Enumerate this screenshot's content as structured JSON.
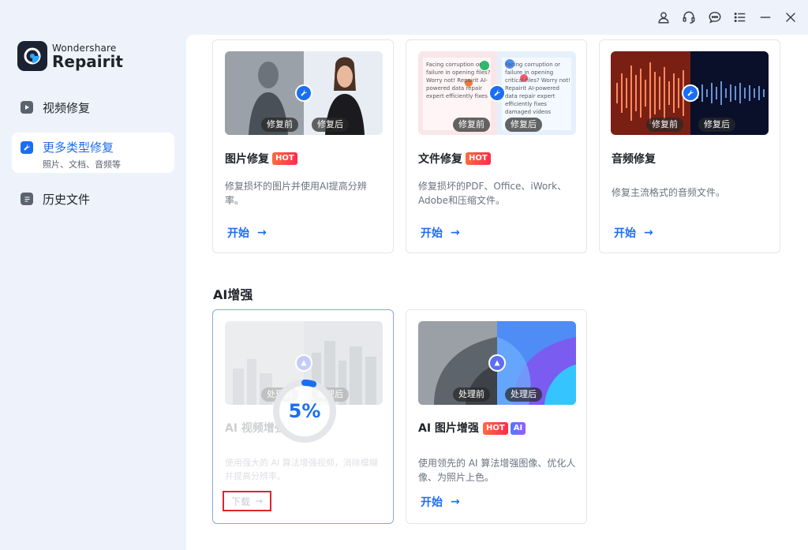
{
  "app": {
    "brand": "Wondershare",
    "product": "Repairit"
  },
  "titlebar": {
    "icons": [
      "account-icon",
      "headset-support-icon",
      "chat-feedback-icon",
      "menu-list-icon",
      "minimize-icon",
      "close-icon"
    ]
  },
  "sidebar": {
    "items": [
      {
        "label": "视频修复",
        "sub": "",
        "active": false,
        "icon": "play-icon"
      },
      {
        "label": "更多类型修复",
        "sub": "照片、文档、音频等",
        "active": true,
        "icon": "wrench-icon"
      },
      {
        "label": "历史文件",
        "sub": "",
        "active": false,
        "icon": "document-icon"
      }
    ]
  },
  "repair_cards": [
    {
      "title": "图片修复",
      "hot": "HOT",
      "desc": "修复损坏的图片并使用AI提高分辨率。",
      "before": "修复前",
      "after": "修复后",
      "action": "开始"
    },
    {
      "title": "文件修复",
      "hot": "HOT",
      "desc": "修复损坏的PDF、Office、iWork、Adobe和压缩文件。",
      "before": "修复前",
      "after": "修复后",
      "action": "开始"
    },
    {
      "title": "音频修复",
      "hot": "",
      "desc": "修复主流格式的音频文件。",
      "before": "修复前",
      "after": "修复后",
      "action": "开始"
    }
  ],
  "ai_section": {
    "title": "AI增强",
    "video_card": {
      "title": "AI 视频增强",
      "desc": "使用强大的 AI 算法增强视频，消除模糊并提高分辨率。",
      "before": "处理前",
      "after": "处理后",
      "progress_percent": 5,
      "progress_label": "5%",
      "action": "下载"
    },
    "image_card": {
      "title": "AI 图片增强",
      "hot": "HOT",
      "ai": "AI",
      "desc": "使用领先的 AI 算法增强图像、优化人像、为照片上色。",
      "before": "处理前",
      "after": "处理后",
      "action": "开始"
    }
  },
  "doc_thumb_text": {
    "left": "Facing corruption or failure in opening files? Worry not! Repairit AI-powered data repair expert efficiently fixes",
    "right": "Facing corruption or failure in opening critical files? Worry not! Repairit AI-powered data repair expert efficiently fixes damaged videos"
  },
  "colors": {
    "accent": "#1b6ef3",
    "hot": "#ff3d3d",
    "highlight_box": "#e0242b"
  }
}
